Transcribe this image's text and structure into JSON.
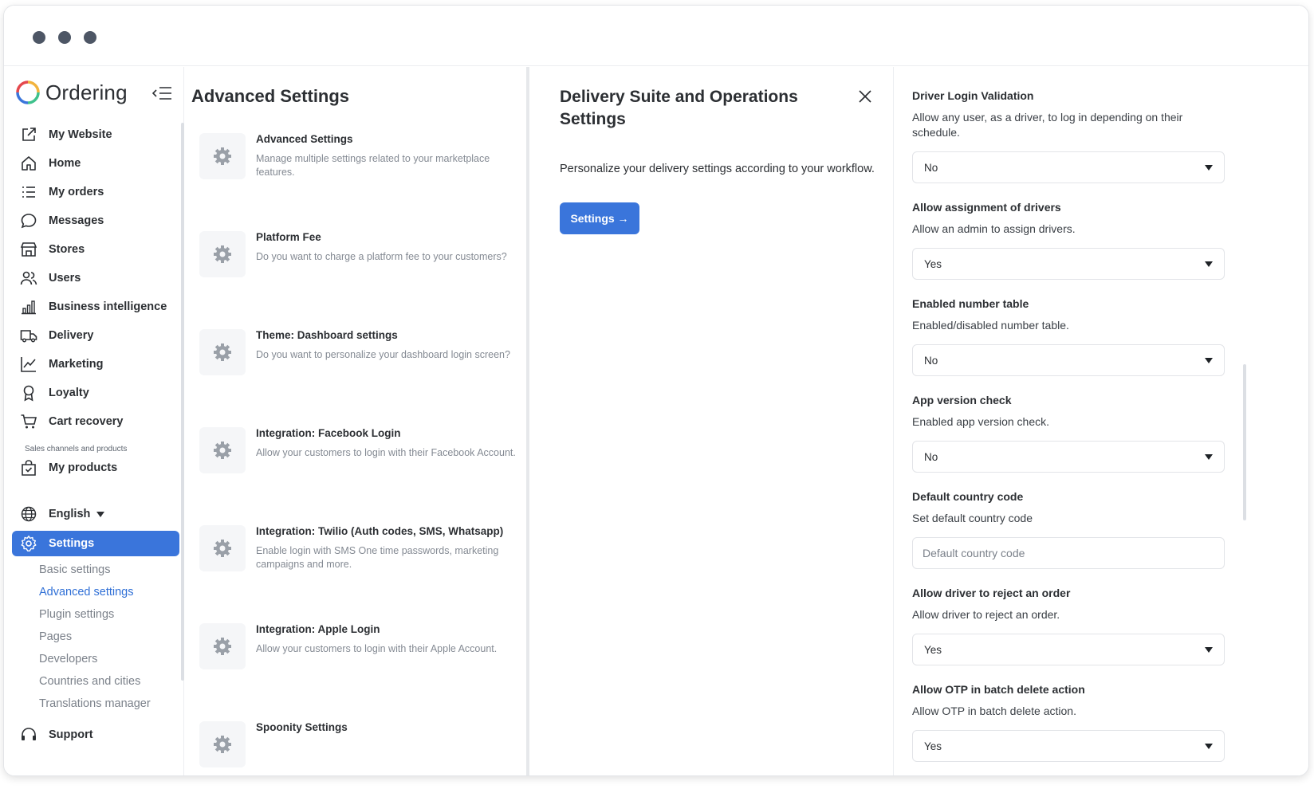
{
  "window": {
    "controls": [
      "close-dot",
      "minimize-dot",
      "maximize-dot"
    ]
  },
  "sidebar": {
    "logo_text": "Ordering",
    "items": [
      {
        "label": "My Website",
        "icon": "external-link-icon"
      },
      {
        "label": "Home",
        "icon": "home-icon"
      },
      {
        "label": "My orders",
        "icon": "list-icon"
      },
      {
        "label": "Messages",
        "icon": "chat-icon"
      },
      {
        "label": "Stores",
        "icon": "shop-icon"
      },
      {
        "label": "Users",
        "icon": "users-icon"
      },
      {
        "label": "Business intelligence",
        "icon": "bar-chart-icon"
      },
      {
        "label": "Delivery",
        "icon": "truck-icon"
      },
      {
        "label": "Marketing",
        "icon": "line-chart-icon"
      },
      {
        "label": "Loyalty",
        "icon": "award-icon"
      },
      {
        "label": "Cart recovery",
        "icon": "cart-icon"
      }
    ],
    "section_label": "Sales channels and products",
    "products": {
      "label": "My products",
      "icon": "bag-check-icon"
    },
    "language": {
      "label": "English",
      "icon": "globe-icon"
    },
    "settings": {
      "label": "Settings",
      "icon": "gear-icon"
    },
    "sub_items": [
      "Basic settings",
      "Advanced settings",
      "Plugin settings",
      "Pages",
      "Developers",
      "Countries and cities",
      "Translations manager"
    ],
    "active_sub": "Advanced settings",
    "support": {
      "label": "Support",
      "icon": "headset-icon"
    }
  },
  "advanced": {
    "title": "Advanced Settings",
    "items": [
      {
        "title": "Advanced Settings",
        "desc": "Manage multiple settings related to your marketplace features."
      },
      {
        "title": "Platform Fee",
        "desc": "Do you want to charge a platform fee to your customers?"
      },
      {
        "title": "Theme: Dashboard settings",
        "desc": "Do you want to personalize your dashboard login screen?"
      },
      {
        "title": "Integration: Facebook Login",
        "desc": "Allow your customers to login with their Facebook Account."
      },
      {
        "title": "Integration: Twilio (Auth codes, SMS, Whatsapp)",
        "desc": "Enable login with SMS One time passwords, marketing campaigns and more."
      },
      {
        "title": "Integration: Apple Login",
        "desc": "Allow your customers to login with their Apple Account."
      },
      {
        "title": "Spoonity Settings",
        "desc": ""
      }
    ]
  },
  "delivery": {
    "title": "Delivery Suite and Operations Settings",
    "description": "Personalize your delivery settings according to your workflow.",
    "button_label": "Settings →"
  },
  "driver": {
    "fields": [
      {
        "title": "Driver Login Validation",
        "desc": "Allow any user, as a driver, to log in depending on their schedule.",
        "value": "No"
      },
      {
        "title": "Allow assignment of drivers",
        "desc": "Allow an admin to assign drivers.",
        "value": "Yes"
      },
      {
        "title": "Enabled number table",
        "desc": "Enabled/disabled number table.",
        "value": "No"
      },
      {
        "title": "App version check",
        "desc": "Enabled app version check.",
        "value": "No"
      },
      {
        "title": "Default country code",
        "desc": "Set default country code",
        "placeholder": "Default country code"
      },
      {
        "title": "Allow driver to reject an order",
        "desc": "Allow driver to reject an order.",
        "value": "Yes"
      },
      {
        "title": "Allow OTP in batch delete action",
        "desc": "Allow OTP in batch delete action.",
        "value": "Yes"
      }
    ]
  },
  "colors": {
    "accent": "#3a75db",
    "text": "#2c2f33",
    "muted": "#848a93"
  }
}
